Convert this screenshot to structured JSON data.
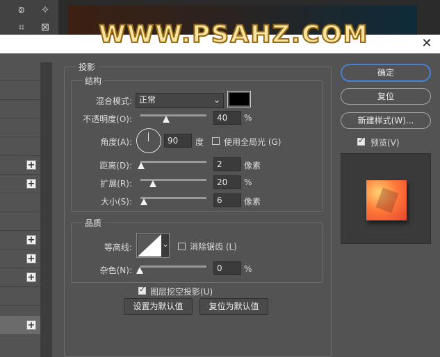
{
  "watermark": "WWW.PSAHZ.COM",
  "toolbar": {
    "tools": [
      {
        "icon": "lasso-polygon-icon",
        "glyph": "⟄"
      },
      {
        "icon": "magic-wand-icon",
        "glyph": "✧"
      },
      {
        "icon": "crop-icon",
        "glyph": "⌗"
      },
      {
        "icon": "frame-icon",
        "glyph": "⊠"
      }
    ]
  },
  "dialog": {
    "close_glyph": "✕",
    "section_title": "投影",
    "structure": {
      "title": "结构",
      "blend_mode_label": "混合模式:",
      "blend_mode_value": "正常",
      "shadow_color": "#000000",
      "opacity_label": "不透明度(O):",
      "opacity_value": "40",
      "opacity_unit": "%",
      "angle_label": "角度(A):",
      "angle_value": "90",
      "angle_unit": "度",
      "global_light_label": "使用全局光 (G)",
      "global_light_checked": false,
      "distance_label": "距离(D):",
      "distance_value": "2",
      "distance_unit": "像素",
      "spread_label": "扩展(R):",
      "spread_value": "20",
      "spread_unit": "%",
      "size_label": "大小(S):",
      "size_value": "6",
      "size_unit": "像素"
    },
    "quality": {
      "title": "品质",
      "contour_label": "等高线:",
      "anti_alias_label": "消除锯齿 (L)",
      "anti_alias_checked": false,
      "noise_label": "杂色(N):",
      "noise_value": "0",
      "noise_unit": "%"
    },
    "knockout_label": "图层挖空投影(U)",
    "knockout_checked": true,
    "set_default_label": "设置为默认值",
    "reset_default_label": "复位为默认值",
    "buttons": {
      "ok": "确定",
      "reset": "复位",
      "new_style": "新建样式(W)...",
      "preview_label": "预览(V)",
      "preview_checked": true
    }
  }
}
